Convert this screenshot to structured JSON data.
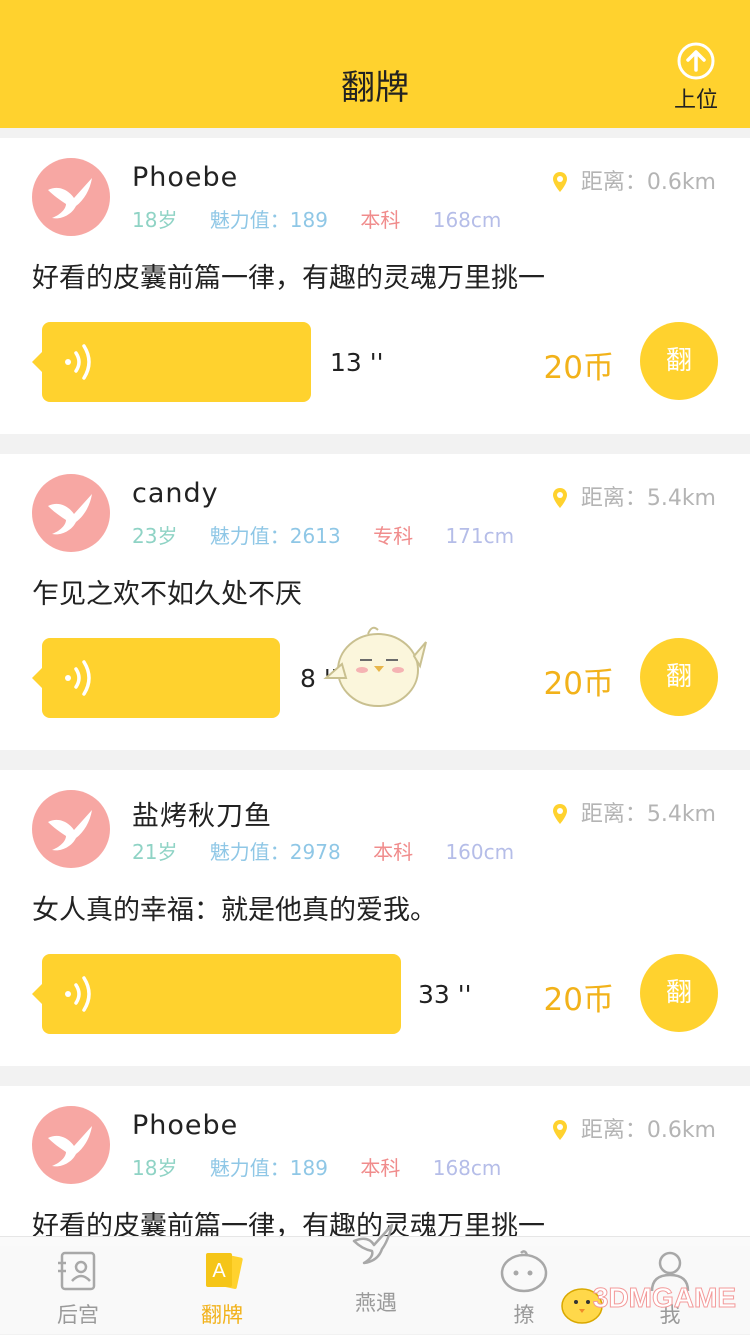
{
  "header": {
    "title": "翻牌",
    "up_label": "上位"
  },
  "cards": [
    {
      "name": "Phoebe",
      "age": "18岁",
      "charm": "魅力值：189",
      "edu": "本科",
      "height": "168cm",
      "distance": "距离：0.6km",
      "motto": "好看的皮囊前篇一律，有趣的灵魂万里挑一",
      "duration": "13 ''",
      "price": "20币",
      "flip": "翻"
    },
    {
      "name": "candy",
      "age": "23岁",
      "charm": "魅力值：2613",
      "edu": "专科",
      "height": "171cm",
      "distance": "距离：5.4km",
      "motto": "乍见之欢不如久处不厌",
      "duration": "8 ''",
      "price": "20币",
      "flip": "翻"
    },
    {
      "name": "盐烤秋刀鱼",
      "age": "21岁",
      "charm": "魅力值：2978",
      "edu": "本科",
      "height": "160cm",
      "distance": "距离：5.4km",
      "motto": "女人真的幸福：就是他真的爱我。",
      "duration": "33 ''",
      "price": "20币",
      "flip": "翻"
    },
    {
      "name": "Phoebe",
      "age": "18岁",
      "charm": "魅力值：189",
      "edu": "本科",
      "height": "168cm",
      "distance": "距离：0.6km",
      "motto": "好看的皮囊前篇一律，有趣的灵魂万里挑一"
    }
  ],
  "tabs": [
    {
      "label": "后宫",
      "icon": "contacts-icon",
      "active": false
    },
    {
      "label": "翻牌",
      "icon": "card-a-icon",
      "active": true
    },
    {
      "label": "燕遇",
      "icon": "swallow-icon",
      "active": false
    },
    {
      "label": "撩",
      "icon": "chat-face-icon",
      "active": false
    },
    {
      "label": "我",
      "icon": "person-icon",
      "active": false
    }
  ],
  "watermark": "3DMGAME",
  "colors": {
    "accent": "#ffd22e",
    "price": "#f2b21a",
    "avatar": "#f7a7a3"
  }
}
